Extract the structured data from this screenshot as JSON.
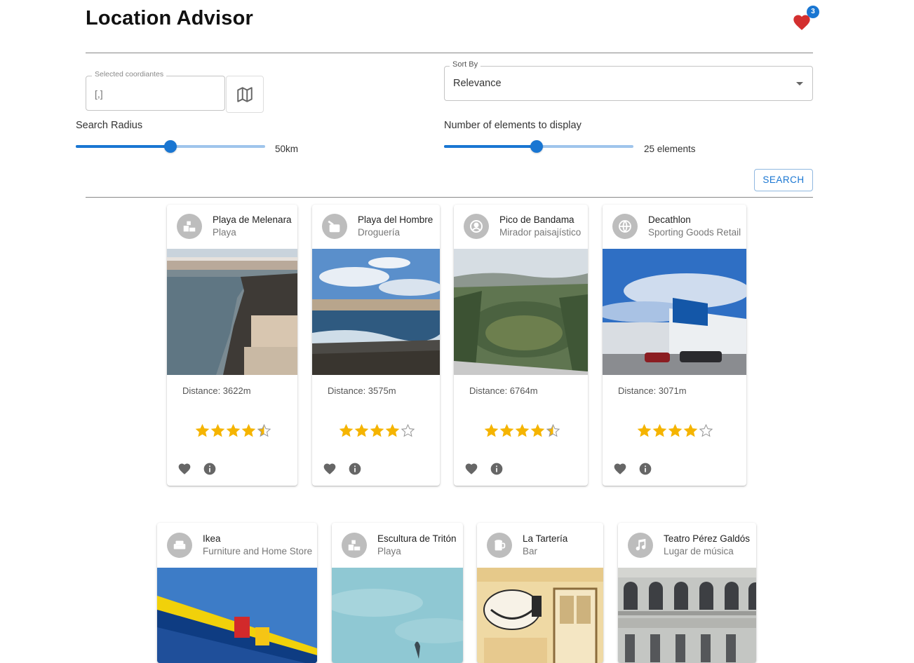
{
  "header": {
    "title": "Location Advisor",
    "favorites_count": "3"
  },
  "filters": {
    "coords_label": "Selected coordiantes",
    "coords_placeholder": "[,]",
    "sort_label": "Sort By",
    "sort_value": "Relevance",
    "radius_label": "Search Radius",
    "radius_value": "50km",
    "radius_fraction": 0.5,
    "count_label": "Number of elements to display",
    "count_value": "25 elements",
    "count_fraction": 0.49,
    "search_label": "SEARCH"
  },
  "cards": [
    {
      "title": "Playa de Melenara",
      "subtitle": "Playa",
      "distance": "Distance: 3622m",
      "rating": 4.5
    },
    {
      "title": "Playa del Hombre",
      "subtitle": "Droguería",
      "distance": "Distance: 3575m",
      "rating": 4
    },
    {
      "title": "Pico de Bandama",
      "subtitle": "Mirador paisajístico",
      "distance": "Distance: 6764m",
      "rating": 4.5
    },
    {
      "title": "Decathlon",
      "subtitle": "Sporting Goods Retail",
      "distance": "Distance: 3071m",
      "rating": 4
    },
    {
      "title": "Ikea",
      "subtitle": "Furniture and Home Store"
    },
    {
      "title": "Escultura de Tritón",
      "subtitle": "Playa"
    },
    {
      "title": "La Tartería",
      "subtitle": "Bar"
    },
    {
      "title": "Teatro Pérez Galdós",
      "subtitle": "Lugar de música"
    }
  ],
  "colors": {
    "accent": "#1976d2",
    "star": "#f5b400",
    "heart": "#d32f2f"
  }
}
